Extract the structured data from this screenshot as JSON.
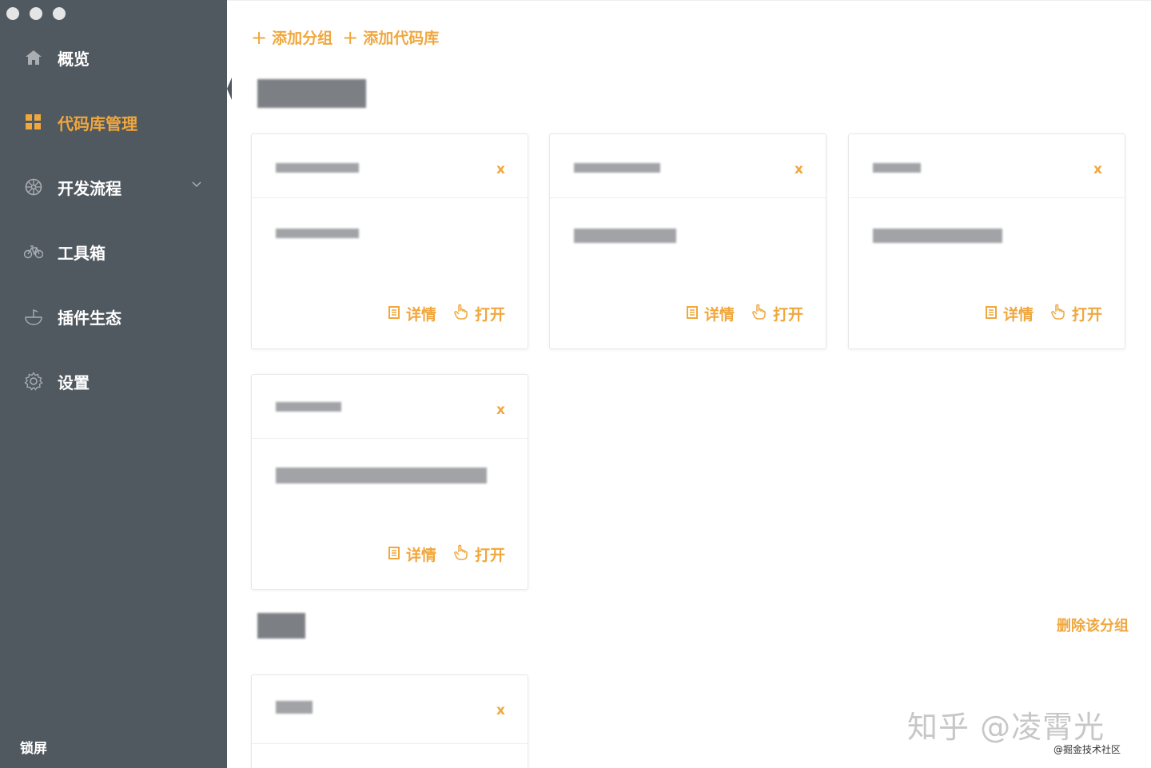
{
  "sidebar": {
    "items": [
      {
        "label": "概览",
        "icon": "home-icon"
      },
      {
        "label": "代码库管理",
        "icon": "grid-icon",
        "active": true
      },
      {
        "label": "开发流程",
        "icon": "wheel-icon",
        "has_children": true
      },
      {
        "label": "工具箱",
        "icon": "bicycle-icon"
      },
      {
        "label": "插件生态",
        "icon": "bowl-icon"
      },
      {
        "label": "设置",
        "icon": "gear-icon"
      }
    ],
    "lock_label": "锁屏"
  },
  "toolbar": {
    "add_group": "添加分组",
    "add_repo": "添加代码库"
  },
  "card_actions": {
    "detail": "详情",
    "open": "打开",
    "close": "x"
  },
  "group2": {
    "delete_label": "删除该分组"
  },
  "watermark": {
    "main": "知乎 @凌霄光",
    "sub": "@掘金技术社区"
  },
  "colors": {
    "accent": "#f0a73d",
    "sidebar_bg": "#515960"
  }
}
